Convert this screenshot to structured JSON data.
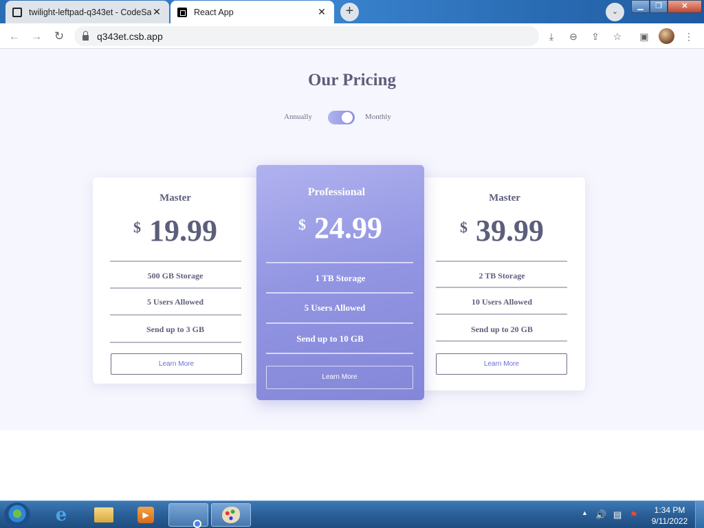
{
  "browser": {
    "tabs": [
      {
        "title": "twilight-leftpad-q343et - CodeSa",
        "active": false
      },
      {
        "title": "React App",
        "active": true
      }
    ],
    "url": "q343et.csb.app"
  },
  "page": {
    "title": "Our Pricing",
    "toggle": {
      "left_label": "Annually",
      "right_label": "Monthly",
      "selected": "Monthly"
    },
    "plans": [
      {
        "name": "Master",
        "currency": "$",
        "price": "19.99",
        "features": [
          "500 GB Storage",
          "5 Users Allowed",
          "Send up to 3 GB"
        ],
        "button": "Learn More"
      },
      {
        "name": "Professional",
        "currency": "$",
        "price": "24.99",
        "features": [
          "1 TB Storage",
          "5 Users Allowed",
          "Send up to 10 GB"
        ],
        "button": "Learn More"
      },
      {
        "name": "Master",
        "currency": "$",
        "price": "39.99",
        "features": [
          "2 TB Storage",
          "10 Users Allowed",
          "Send up to 20 GB"
        ],
        "button": "Learn More"
      }
    ]
  },
  "taskbar": {
    "clock": {
      "time": "1:34 PM",
      "date": "9/11/2022"
    }
  },
  "colors": {
    "page_bg": "#f6f6fe",
    "text_dark": "#5c5f7a",
    "featured_gradient_start": "#b0b2ef",
    "featured_gradient_end": "#8486d8",
    "button_text": "#6a6ed4"
  }
}
